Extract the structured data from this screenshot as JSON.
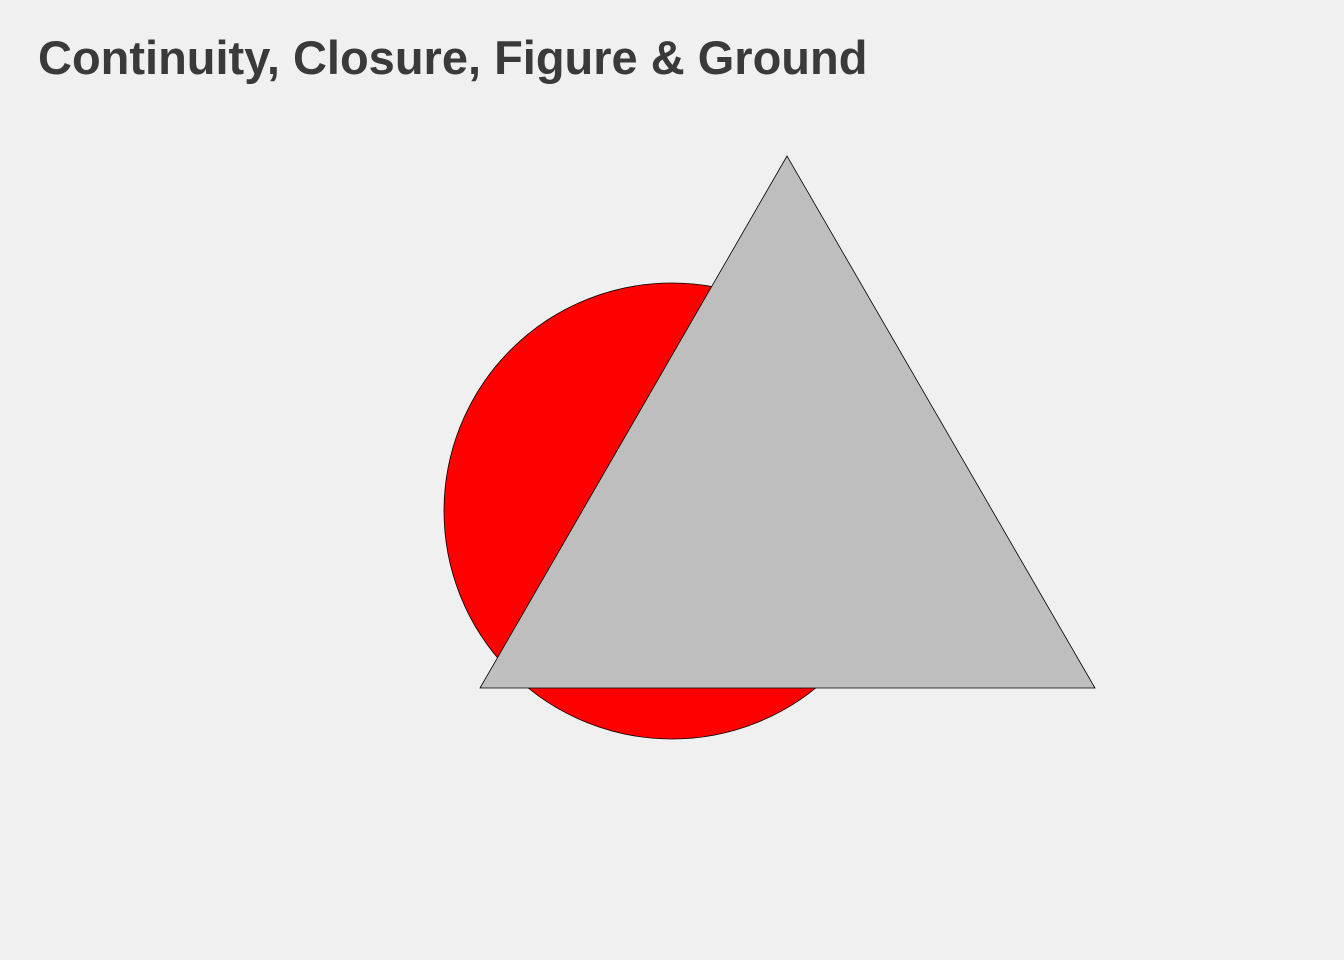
{
  "title": "Continuity, Closure, Figure & Ground",
  "background_color": "#f0f0f0",
  "title_color": "#3a3a3a",
  "shapes": {
    "circle": {
      "fill": "#ff0000",
      "stroke": "#000000"
    },
    "triangle": {
      "fill": "#bebebe",
      "stroke": "#000000"
    }
  }
}
